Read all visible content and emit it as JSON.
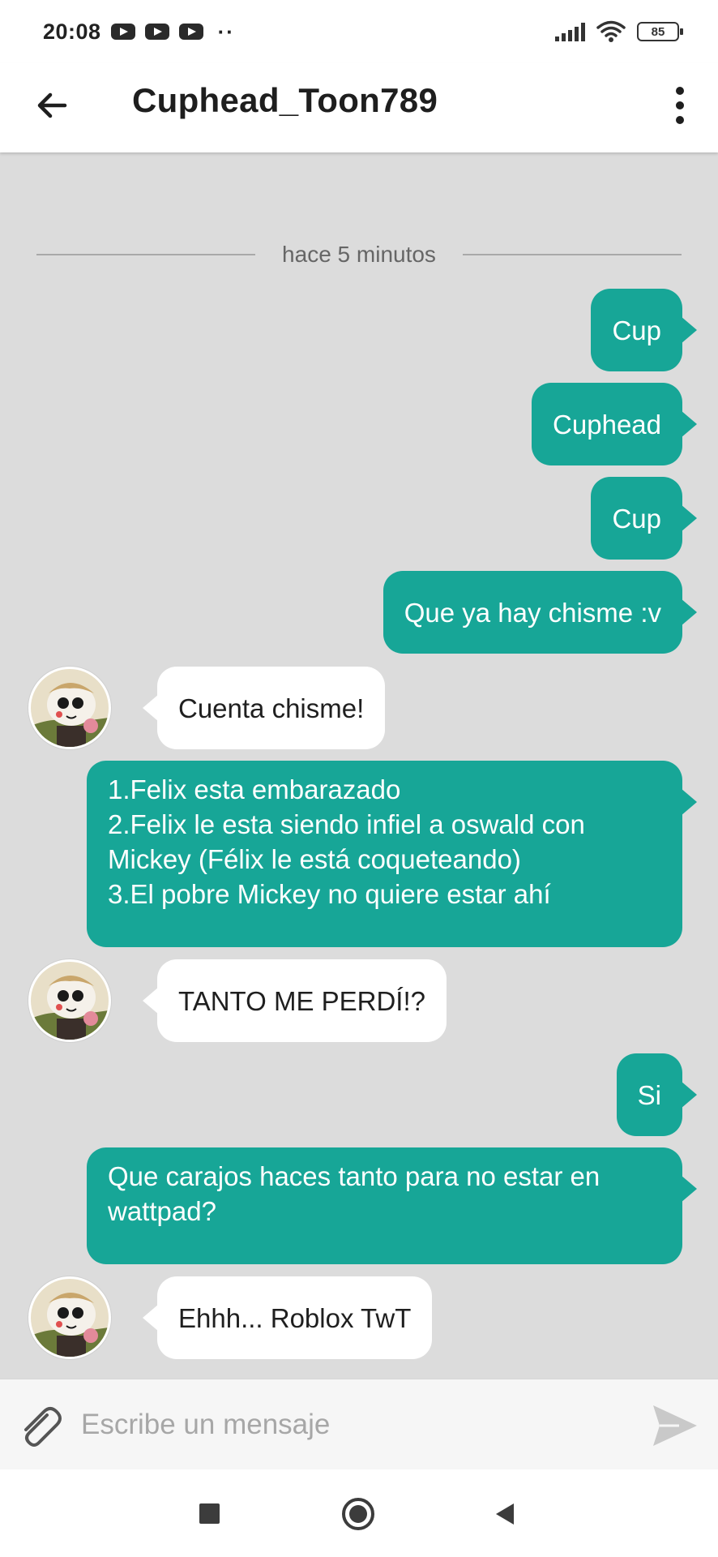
{
  "status_bar": {
    "time": "20:08",
    "notification_icons": [
      "youtube-icon",
      "youtube-icon",
      "youtube-icon"
    ],
    "more_indicator": "··",
    "battery": "85",
    "signal_icon": "signal-icon",
    "wifi_icon": "wifi-icon"
  },
  "app_bar": {
    "back_icon": "arrow-left-icon",
    "title": "Cuphead_Toon789",
    "menu_icon": "more-vertical-icon"
  },
  "chat": {
    "timestamp": "hace 5 minutos",
    "messages": [
      {
        "direction": "out",
        "text": "Cup"
      },
      {
        "direction": "out",
        "text": "Cuphead"
      },
      {
        "direction": "out",
        "text": "Cup"
      },
      {
        "direction": "out",
        "text": "Que ya hay chisme :v"
      },
      {
        "direction": "in",
        "text": "Cuenta chisme!"
      },
      {
        "direction": "out",
        "text": "1.Felix esta embarazado\n2.Felix le esta siendo infiel a oswald con Mickey (Félix le está coqueteando)\n3.El pobre Mickey no quiere estar ahí"
      },
      {
        "direction": "in",
        "text": "TANTO ME PERDÍ!?"
      },
      {
        "direction": "out",
        "text": "Si"
      },
      {
        "direction": "out",
        "text": "Que carajos haces tanto para no estar en wattpad?"
      },
      {
        "direction": "in",
        "text": "Ehhh... Roblox TwT"
      }
    ]
  },
  "composer": {
    "attach_icon": "paperclip-icon",
    "placeholder": "Escribe un mensaje",
    "send_icon": "send-icon"
  },
  "nav_bar": {
    "recents_icon": "square-icon",
    "home_icon": "circle-icon",
    "back_icon": "triangle-back-icon"
  },
  "colors": {
    "outgoing_bubble": "#17a697",
    "incoming_bubble": "#ffffff",
    "chat_background": "#dcdcdc"
  }
}
